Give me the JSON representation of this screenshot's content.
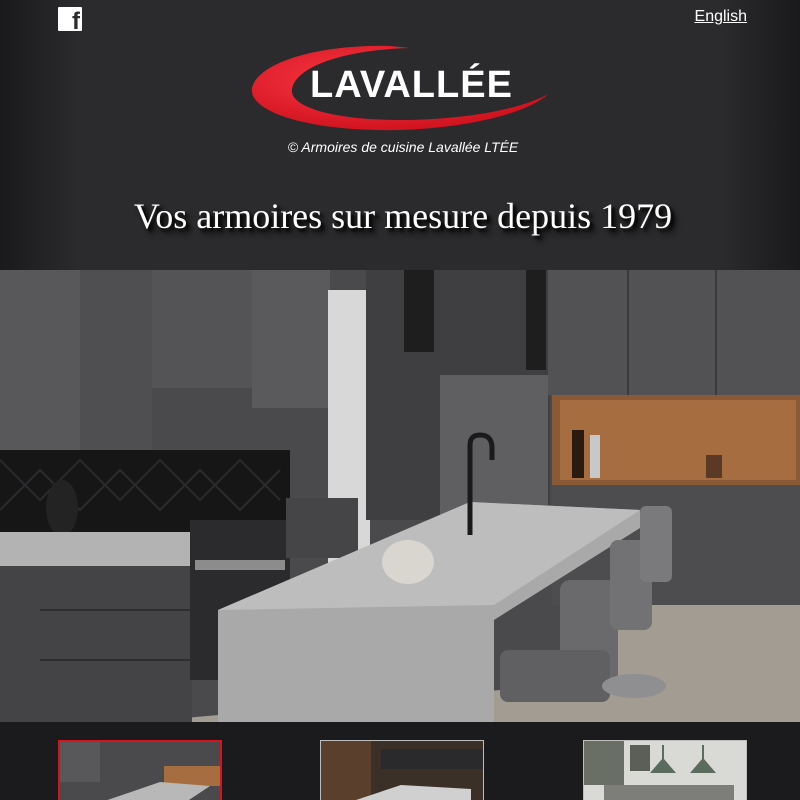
{
  "header": {
    "facebook_icon": "facebook-icon",
    "language_link": "English",
    "logo_text": "LAVALLÉE",
    "copyright": "© Armoires de cuisine Lavallée LTÉE",
    "tagline": "Vos armoires sur mesure depuis 1979"
  },
  "colors": {
    "header_bg": "#2b2b2d",
    "accent_red": "#d8131f",
    "text": "#ffffff"
  },
  "hero": {
    "image": "kitchen-photo-dark-grey-cabinets-island"
  },
  "gallery": {
    "active_index": 0,
    "thumbnails": [
      "kitchen-thumbnail-1",
      "kitchen-thumbnail-2",
      "kitchen-thumbnail-3"
    ]
  }
}
